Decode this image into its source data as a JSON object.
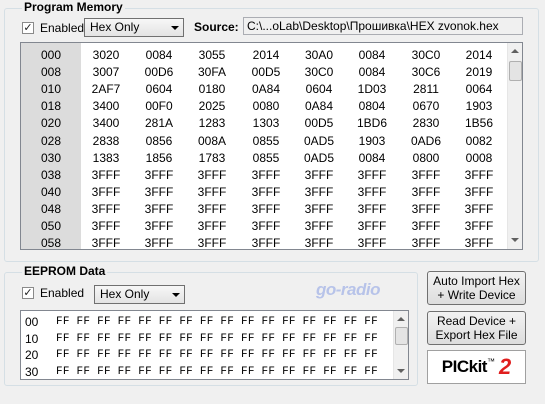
{
  "program_memory": {
    "title": "Program Memory",
    "enabled_label": "Enabled",
    "enabled_checked": true,
    "mode": "Hex Only",
    "source_label": "Source:",
    "source_path": "C:\\...oLab\\Desktop\\Прошивка\\HEX zvonok.hex",
    "rows": [
      {
        "addr": "000",
        "cells": [
          "3020",
          "0084",
          "3055",
          "2014",
          "30A0",
          "0084",
          "30C0",
          "2014"
        ]
      },
      {
        "addr": "008",
        "cells": [
          "3007",
          "00D6",
          "30FA",
          "00D5",
          "30C0",
          "0084",
          "30C6",
          "2019"
        ]
      },
      {
        "addr": "010",
        "cells": [
          "2AF7",
          "0604",
          "0180",
          "0A84",
          "0604",
          "1D03",
          "2811",
          "0064"
        ]
      },
      {
        "addr": "018",
        "cells": [
          "3400",
          "00F0",
          "2025",
          "0080",
          "0A84",
          "0804",
          "0670",
          "1903"
        ]
      },
      {
        "addr": "020",
        "cells": [
          "3400",
          "281A",
          "1283",
          "1303",
          "00D5",
          "1BD6",
          "2830",
          "1B56"
        ]
      },
      {
        "addr": "028",
        "cells": [
          "2838",
          "0856",
          "008A",
          "0855",
          "0AD5",
          "1903",
          "0AD6",
          "0082"
        ]
      },
      {
        "addr": "030",
        "cells": [
          "1383",
          "1856",
          "1783",
          "0855",
          "0AD5",
          "0084",
          "0800",
          "0008"
        ]
      },
      {
        "addr": "038",
        "cells": [
          "3FFF",
          "3FFF",
          "3FFF",
          "3FFF",
          "3FFF",
          "3FFF",
          "3FFF",
          "3FFF"
        ]
      },
      {
        "addr": "040",
        "cells": [
          "3FFF",
          "3FFF",
          "3FFF",
          "3FFF",
          "3FFF",
          "3FFF",
          "3FFF",
          "3FFF"
        ]
      },
      {
        "addr": "048",
        "cells": [
          "3FFF",
          "3FFF",
          "3FFF",
          "3FFF",
          "3FFF",
          "3FFF",
          "3FFF",
          "3FFF"
        ]
      },
      {
        "addr": "050",
        "cells": [
          "3FFF",
          "3FFF",
          "3FFF",
          "3FFF",
          "3FFF",
          "3FFF",
          "3FFF",
          "3FFF"
        ]
      },
      {
        "addr": "058",
        "cells": [
          "3FFF",
          "3FFF",
          "3FFF",
          "3FFF",
          "3FFF",
          "3FFF",
          "3FFF",
          "3FFF"
        ]
      }
    ]
  },
  "eeprom": {
    "title": "EEPROM Data",
    "enabled_label": "Enabled",
    "enabled_checked": true,
    "mode": "Hex Only",
    "rows": [
      {
        "addr": "00",
        "data": "FF FF FF FF FF FF FF FF FF FF FF FF FF FF FF FF"
      },
      {
        "addr": "10",
        "data": "FF FF FF FF FF FF FF FF FF FF FF FF FF FF FF FF"
      },
      {
        "addr": "20",
        "data": "FF FF FF FF FF FF FF FF FF FF FF FF FF FF FF FF"
      },
      {
        "addr": "30",
        "data": "FF FF FF FF FF FF FF FF FF FF FF FF FF FF FF FF"
      }
    ]
  },
  "watermark": "go-radio",
  "buttons": {
    "auto_import": "Auto Import Hex + Write Device",
    "read_export": "Read Device + Export Hex File"
  },
  "logo": {
    "name": "PICkit",
    "tm": "™",
    "version": "2"
  },
  "colors": {
    "logo_red": "#e01e1e",
    "addr_bg": "#dcdcdc"
  }
}
